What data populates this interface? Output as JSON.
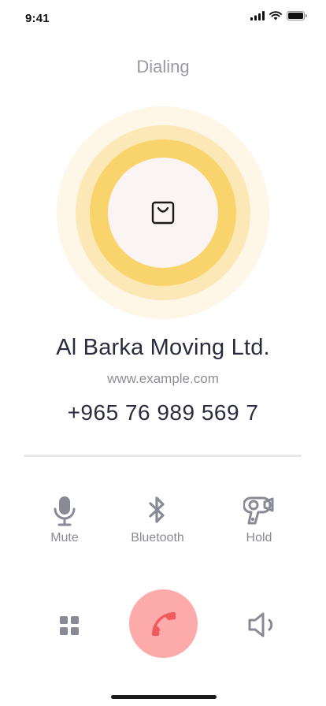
{
  "status_bar": {
    "time": "9:41"
  },
  "call": {
    "state": "Dialing",
    "contact_name": "Al Barka Moving Ltd.",
    "website": "www.example.com",
    "phone": "+965 76 989 569 7"
  },
  "actions": [
    {
      "label": "Mute",
      "icon": "microphone-icon"
    },
    {
      "label": "Bluetooth",
      "icon": "bluetooth-icon"
    },
    {
      "label": "Hold",
      "icon": "hold-icon"
    }
  ],
  "controls": {
    "keypad_icon": "keypad-icon",
    "end_call_icon": "phone-hangup-icon",
    "speaker_icon": "speaker-icon"
  },
  "colors": {
    "ring_outer": "#fef6e7",
    "ring_middle": "#fbe8b6",
    "ring_inner": "#f9d46c",
    "avatar_bg": "#faf4f4",
    "end_call_bg": "#fdaaaa",
    "end_call_icon": "#f05a5a",
    "icon_gray": "#8a8a95"
  }
}
